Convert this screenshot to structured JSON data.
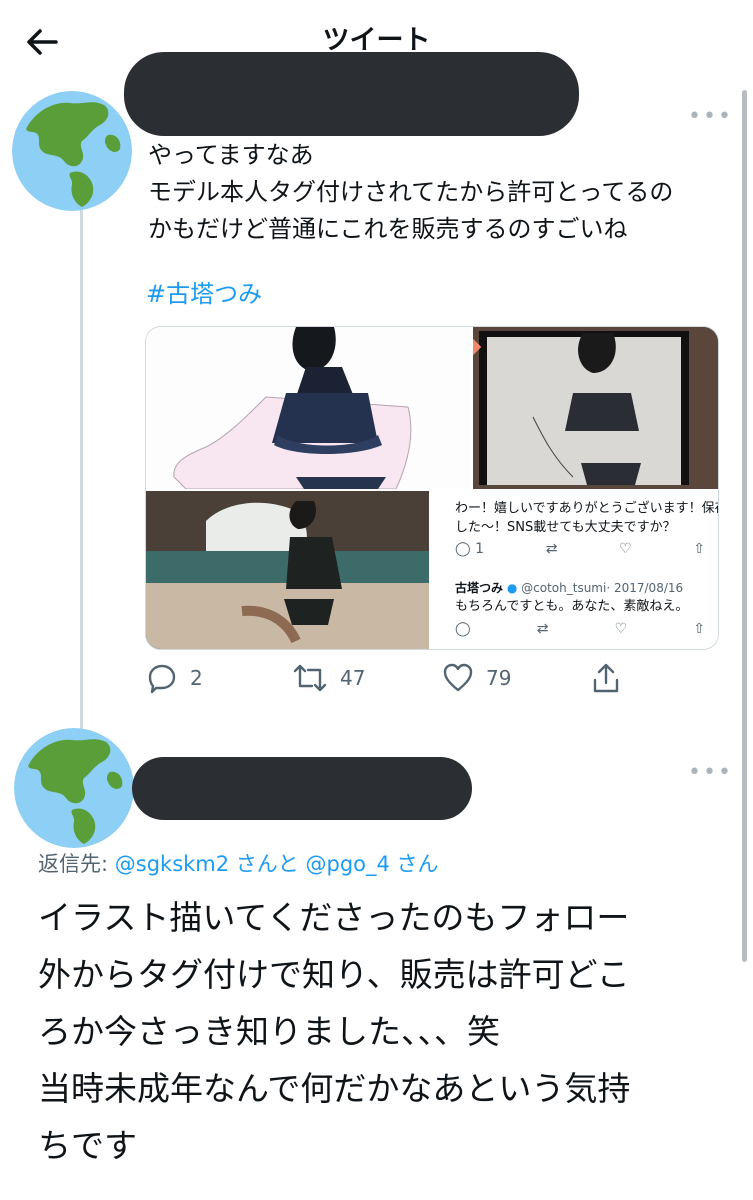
{
  "header": {
    "title": "ツイート"
  },
  "tweet1": {
    "text_lines": [
      "やってますなあ",
      "モデル本人タグ付けされてたから許可とってるの",
      "かもだけど普通にこれを販売するのすごいね"
    ],
    "hashtag": "#古塔つみ",
    "quoted": {
      "text_line1": "わー！嬉しいですありがとうございます！保存",
      "text_line2": "した〜！SNS載せても大丈夫ですか？",
      "reply_count": "1",
      "author_name": "古塔つみ",
      "author_handle": "@cotoh_tsumi",
      "date": "· 2017/08/16",
      "reply_text": "もちろんですとも。あなた、素敵ねえ。"
    },
    "stats": {
      "replies": "2",
      "retweets": "47",
      "likes": "79"
    }
  },
  "tweet2": {
    "reply_prefix": "返信先: ",
    "reply_mention1": "@sgkskm2",
    "reply_mid": " さんと ",
    "reply_mention2": "@pgo_4",
    "reply_suffix": " さん",
    "text_lines": [
      "イラスト描いてくださったのもフォロー",
      "外からタグ付けで知り、販売は許可どこ",
      "ろか今さっき知りました、、、笑",
      "当時未成年なんで何だかなあという気持",
      "ちです"
    ]
  },
  "colors": {
    "accent": "#1d9bf0",
    "text": "#0f1419",
    "muted": "#536471",
    "redaction": "#2b2f33"
  },
  "icons": [
    "back-arrow-icon",
    "globe-avatar-icon",
    "more-icon",
    "reply-icon",
    "retweet-icon",
    "like-icon",
    "share-icon",
    "verified-icon"
  ]
}
